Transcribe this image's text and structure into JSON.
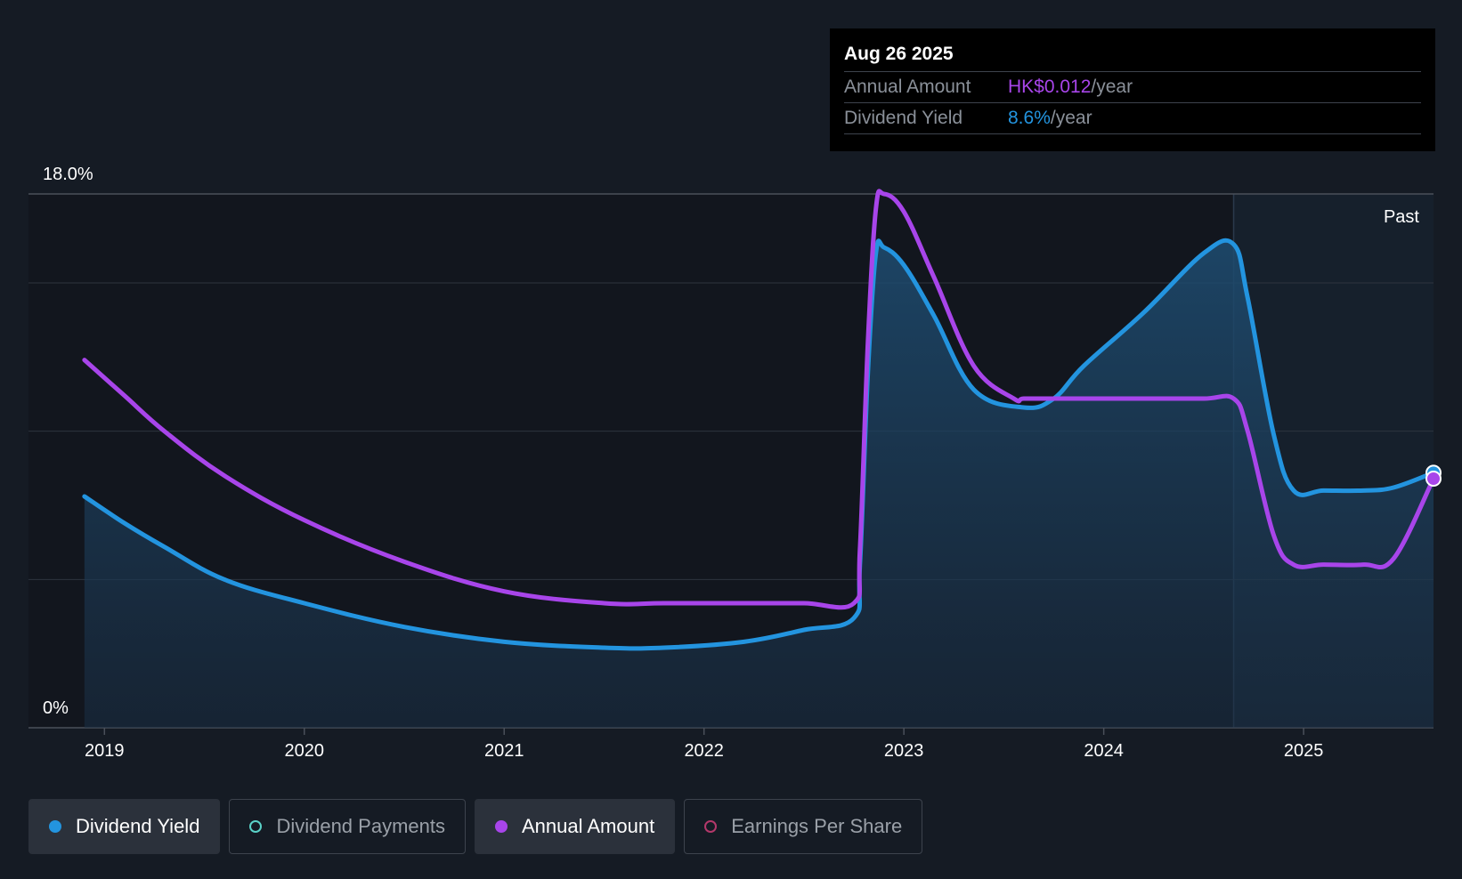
{
  "colors": {
    "background": "#151b24",
    "yield": "#2394df",
    "annual": "#a845ea",
    "payments": "#5ad2c8",
    "eps": "#b3386a"
  },
  "tooltip": {
    "date": "Aug 26 2025",
    "annual_label": "Annual Amount",
    "annual_value": "HK$0.012",
    "annual_unit": "/year",
    "yield_label": "Dividend Yield",
    "yield_value": "8.6%",
    "yield_unit": "/year"
  },
  "chart_data": {
    "type": "line",
    "y_top_label": "18.0%",
    "y_bottom_label": "0%",
    "ylim": [
      0,
      18
    ],
    "xlim": [
      2018.62,
      2025.65
    ],
    "past_label": "Past",
    "past_start": 2024.65,
    "x_ticks": [
      "2019",
      "2020",
      "2021",
      "2022",
      "2023",
      "2024",
      "2025"
    ],
    "x_tick_values": [
      2019,
      2020,
      2021,
      2022,
      2023,
      2024,
      2025
    ],
    "series": [
      {
        "name": "Dividend Yield",
        "key": "yield",
        "filled": true,
        "x": [
          2018.9,
          2019.1,
          2019.3,
          2019.6,
          2020.0,
          2020.5,
          2021.0,
          2021.5,
          2021.8,
          2022.2,
          2022.5,
          2022.75,
          2022.78,
          2022.82,
          2022.86,
          2022.9,
          2023.0,
          2023.15,
          2023.35,
          2023.6,
          2023.75,
          2023.9,
          2024.2,
          2024.5,
          2024.65,
          2024.72,
          2024.85,
          2024.95,
          2025.1,
          2025.3,
          2025.45,
          2025.65
        ],
        "y": [
          7.8,
          6.9,
          6.1,
          5.0,
          4.2,
          3.4,
          2.9,
          2.7,
          2.7,
          2.9,
          3.3,
          3.7,
          5.5,
          12.0,
          16.0,
          16.2,
          15.6,
          13.9,
          11.4,
          10.8,
          11.1,
          12.2,
          14.0,
          16.0,
          16.3,
          14.5,
          9.9,
          8.0,
          8.0,
          8.0,
          8.1,
          8.6
        ]
      },
      {
        "name": "Annual Amount",
        "key": "annual",
        "filled": false,
        "x": [
          2018.9,
          2019.1,
          2019.3,
          2019.6,
          2020.0,
          2020.5,
          2021.0,
          2021.5,
          2021.8,
          2022.2,
          2022.5,
          2022.75,
          2022.78,
          2022.82,
          2022.86,
          2022.9,
          2023.0,
          2023.15,
          2023.35,
          2023.55,
          2023.6,
          2023.75,
          2023.9,
          2024.2,
          2024.5,
          2024.65,
          2024.72,
          2024.85,
          2024.95,
          2025.1,
          2025.3,
          2025.45,
          2025.65
        ],
        "y": [
          12.4,
          11.2,
          10.0,
          8.5,
          7.0,
          5.6,
          4.6,
          4.2,
          4.2,
          4.2,
          4.2,
          4.2,
          6.0,
          13.0,
          17.5,
          18.0,
          17.4,
          15.2,
          12.2,
          11.1,
          11.1,
          11.1,
          11.1,
          11.1,
          11.1,
          11.1,
          10.0,
          6.5,
          5.5,
          5.5,
          5.5,
          5.7,
          8.4
        ]
      }
    ]
  },
  "legend": [
    {
      "label": "Dividend Yield",
      "active": true,
      "dot": "filled",
      "color_key": "yield"
    },
    {
      "label": "Dividend Payments",
      "active": false,
      "dot": "ring",
      "color_key": "payments"
    },
    {
      "label": "Annual Amount",
      "active": true,
      "dot": "filled",
      "color_key": "annual"
    },
    {
      "label": "Earnings Per Share",
      "active": false,
      "dot": "ring",
      "color_key": "eps"
    }
  ]
}
